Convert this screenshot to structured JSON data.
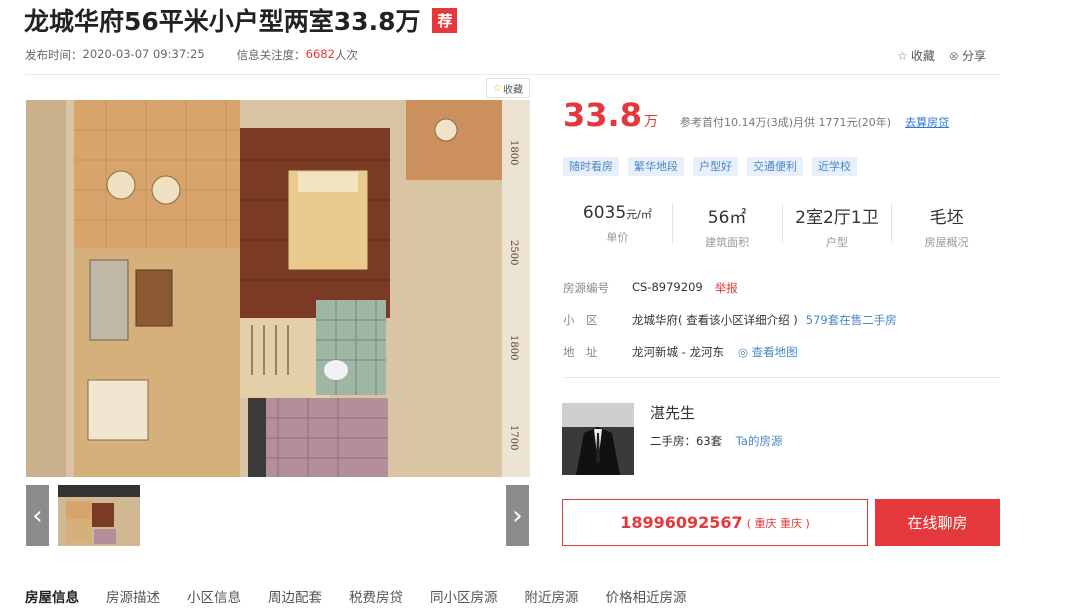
{
  "listing": {
    "title": "龙城华府56平米小户型两室33.8万",
    "badge": "荐",
    "publish_label": "发布时间：",
    "publish_time": "2020-03-07 09:37:25",
    "views_label": "信息关注度：",
    "views_count": "6682",
    "views_unit": " 人次"
  },
  "actions": {
    "favorite": "收藏",
    "share": "分享"
  },
  "gallery": {
    "mini_favorite": "收藏",
    "prev": "‹",
    "next": "›"
  },
  "price": {
    "value": "33.8",
    "unit": "万",
    "reference": "参考首付10.14万(3成)月供 1771元(20年)",
    "loan_link": "去算房贷"
  },
  "tags": [
    "随时看房",
    "繁华地段",
    "户型好",
    "交通便利",
    "近学校"
  ],
  "stats": [
    {
      "value": "6035",
      "unit": "元/㎡",
      "label": "单价"
    },
    {
      "value": "56㎡",
      "unit": "",
      "label": "建筑面积"
    },
    {
      "value": "2室2厅1卫",
      "unit": "",
      "label": "户型"
    },
    {
      "value": "毛坯",
      "unit": "",
      "label": "房屋概况"
    }
  ],
  "info": {
    "code_label": "房源编号",
    "code_value": "CS-8979209",
    "report": "举报",
    "community_label": "小　区",
    "community_value": "龙城华府( 查看该小区详细介绍 )",
    "community_link": "579套在售二手房",
    "address_label": "地　址",
    "address_value": "龙河新城 - 龙河东",
    "map_link": "查看地图"
  },
  "agent": {
    "name": "湛先生",
    "listings": "二手房：63套",
    "listings_link": "Ta的房源"
  },
  "contact": {
    "phone": "18996092567",
    "city": "( 重庆 重庆 )",
    "chat": "在线聊房"
  },
  "tabs": [
    "房屋信息",
    "房源描述",
    "小区信息",
    "周边配套",
    "税费房贷",
    "同小区房源",
    "附近房源",
    "价格相近房源"
  ],
  "colors": {
    "accent_red": "#e4393c",
    "link_blue": "#4a86c5",
    "tag_bg": "#e8f1fb"
  }
}
